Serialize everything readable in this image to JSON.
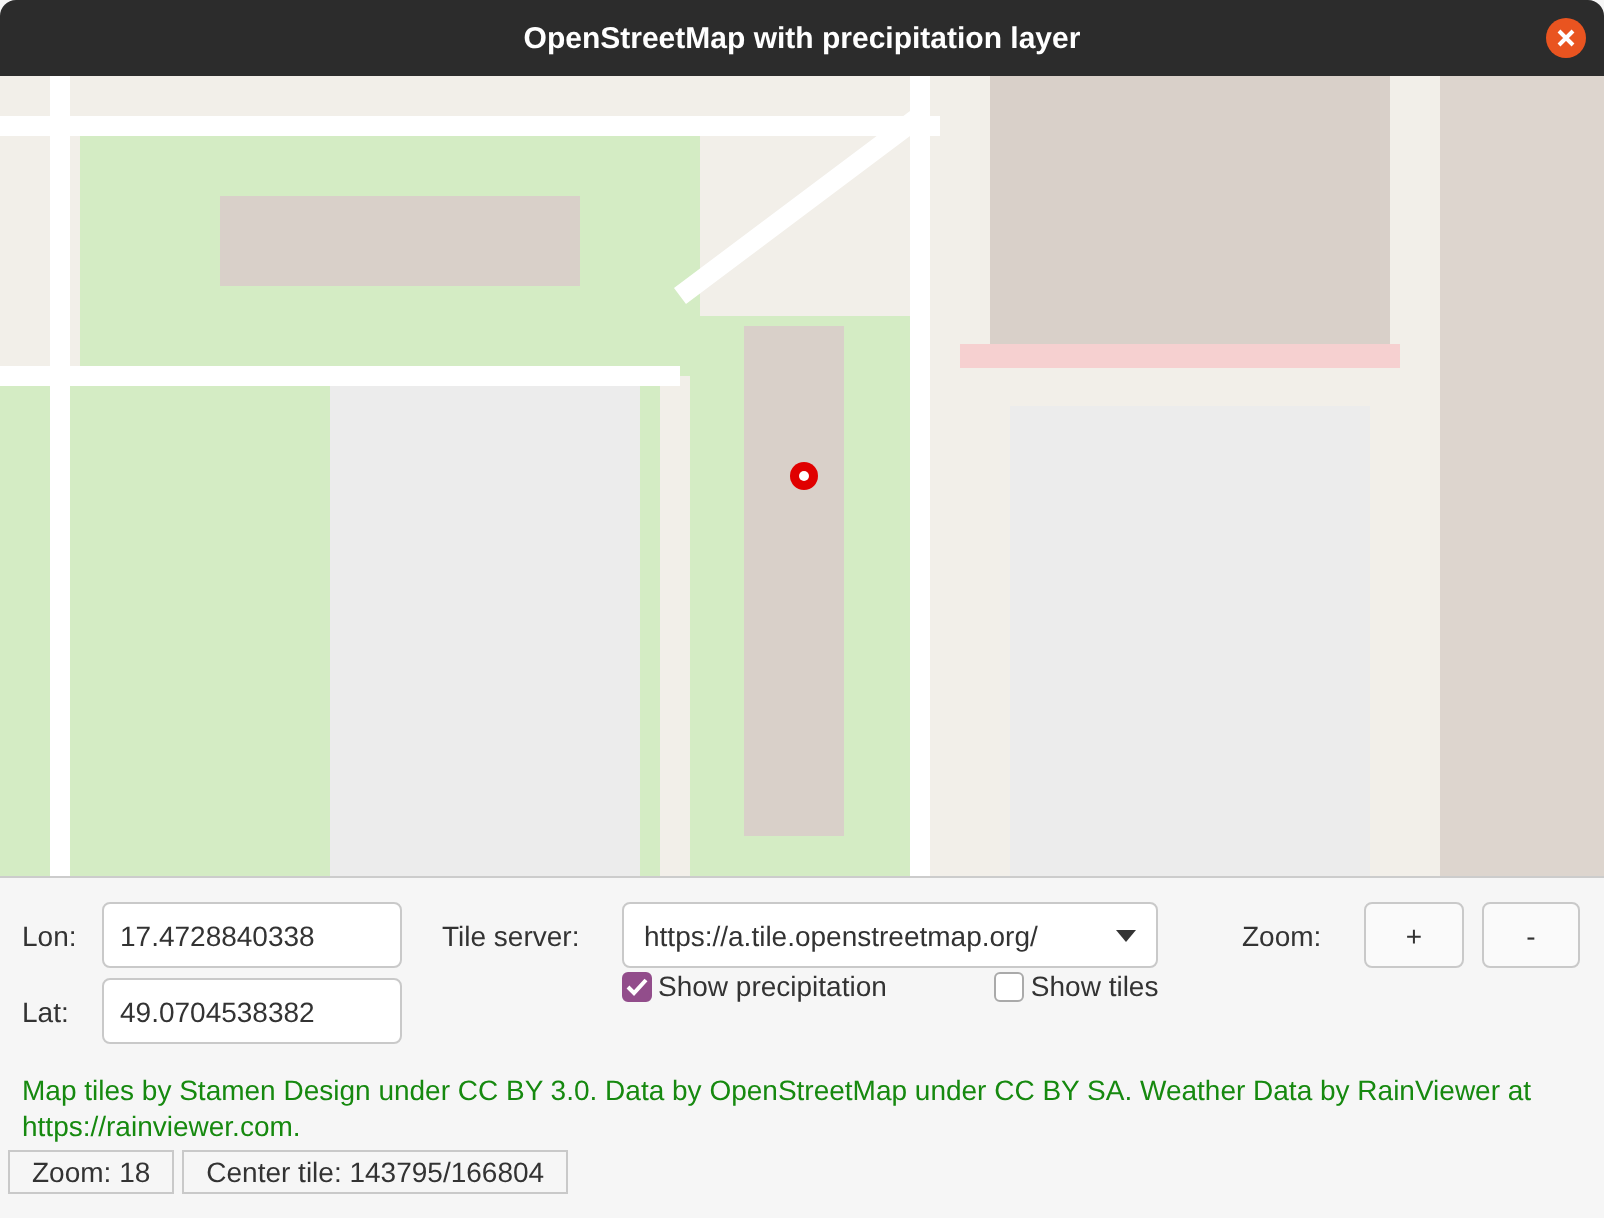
{
  "window": {
    "title": "OpenStreetMap with precipitation layer"
  },
  "controls": {
    "lon": {
      "label": "Lon:",
      "value": "17.4728840338"
    },
    "lat": {
      "label": "Lat:",
      "value": "49.0704538382"
    },
    "tile_server": {
      "label": "Tile server:",
      "value": "https://a.tile.openstreetmap.org/"
    },
    "zoom": {
      "label": "Zoom:",
      "buttons": [
        "+",
        "-"
      ]
    },
    "checkboxes": [
      {
        "label": "Show precipitation",
        "checked": true
      },
      {
        "label": "Show tiles",
        "checked": false
      }
    ]
  },
  "attribution": "Map tiles by Stamen Design under CC BY 3.0. Data by OpenStreetMap under CC BY SA. Weather Data by RainViewer at https://rainviewer.com.",
  "status_bar": [
    "Zoom: 18",
    "Center tile: 143795/166804"
  ]
}
